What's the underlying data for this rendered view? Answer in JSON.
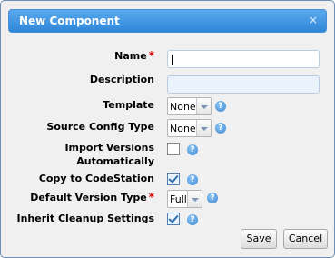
{
  "dialog": {
    "title": "New Component",
    "close_glyph": "×",
    "close_icon": "close-icon"
  },
  "fields": {
    "name": {
      "label": "Name",
      "required": "*",
      "value": ""
    },
    "description": {
      "label": "Description",
      "value": ""
    },
    "template": {
      "label": "Template",
      "selected": "None"
    },
    "source_config_type": {
      "label": "Source Config Type",
      "selected": "None"
    },
    "import_versions": {
      "label_line1": "Import Versions",
      "label_line2": "Automatically",
      "checked": false
    },
    "copy_to_codestation": {
      "label": "Copy to CodeStation",
      "checked": true
    },
    "default_version_type": {
      "label": "Default Version Type",
      "required": "*",
      "selected": "Full"
    },
    "inherit_cleanup": {
      "label": "Inherit Cleanup Settings",
      "checked": true
    }
  },
  "help_glyph": "?",
  "buttons": {
    "save": "Save",
    "cancel": "Cancel"
  },
  "colors": {
    "title_bar": "#2f86d9",
    "required": "#d40000",
    "help_icon": "#3a87d4"
  }
}
